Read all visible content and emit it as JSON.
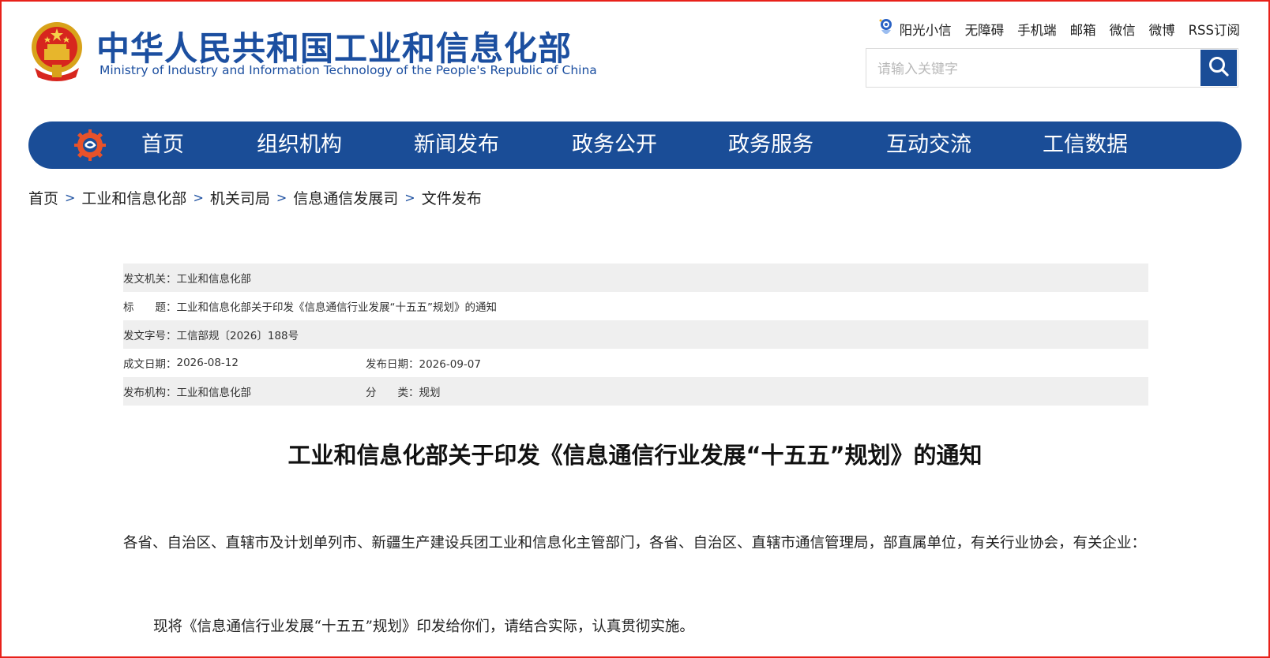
{
  "header": {
    "title": "中华人民共和国工业和信息化部",
    "subtitle": "Ministry of Industry and Information Technology of the People's Republic of China"
  },
  "top_links": [
    "阳光小信",
    "无障碍",
    "手机端",
    "邮箱",
    "微信",
    "微博",
    "RSS订阅"
  ],
  "search": {
    "placeholder": "请输入关键字"
  },
  "nav": {
    "items": [
      "首页",
      "组织机构",
      "新闻发布",
      "政务公开",
      "政务服务",
      "互动交流",
      "工信数据"
    ]
  },
  "breadcrumb": [
    "首页",
    "工业和信息化部",
    "机关司局",
    "信息通信发展司",
    "文件发布"
  ],
  "meta": {
    "issuer_label": "发文机关：",
    "issuer": "工业和信息化部",
    "title_label": "标　　题：",
    "title": "工业和信息化部关于印发《信息通信行业发展“十五五”规划》的通知",
    "doc_no_label": "发文字号：",
    "doc_no": "工信部规〔2026〕188号",
    "written_label": "成文日期：",
    "written": "2026-08-12",
    "published_label": "发布日期：",
    "published": "2026-09-07",
    "org_label": "发布机构：",
    "org": "工业和信息化部",
    "category_label": "分　　类：",
    "category": "规划"
  },
  "document": {
    "title": "工业和信息化部关于印发《信息通信行业发展“十五五”规划》的通知",
    "paragraph1": "各省、自治区、直辖市及计划单列市、新疆生产建设兵团工业和信息化主管部门，各省、自治区、直辖市通信管理局，部直属单位，有关行业协会，有关企业：",
    "paragraph2": "现将《信息通信行业发展“十五五”规划》印发给你们，请结合实际，认真贯彻实施。"
  },
  "colors": {
    "brand_blue": "#1a4d97",
    "frame_red": "#e8211a",
    "meta_shade": "#efefef"
  }
}
